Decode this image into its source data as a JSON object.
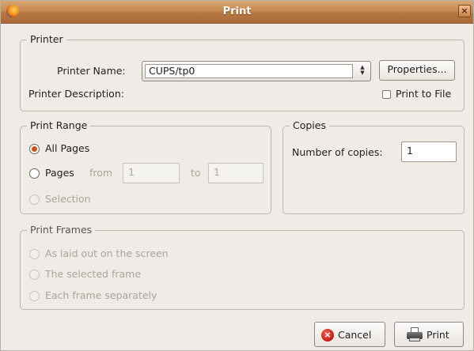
{
  "window": {
    "title": "Print",
    "close_glyph": "×"
  },
  "printer": {
    "group_label": "Printer",
    "name_label": "Printer Name:",
    "selected_printer": "CUPS/tp0",
    "properties_label": "Properties...",
    "description_label": "Printer Description:",
    "print_to_file_label": "Print to File",
    "print_to_file_checked": false
  },
  "print_range": {
    "group_label": "Print Range",
    "all_pages_label": "All Pages",
    "all_pages_selected": true,
    "pages_label": "Pages",
    "from_label": "from",
    "from_value": "1",
    "to_label": "to",
    "to_value": "1",
    "selection_label": "Selection"
  },
  "copies": {
    "group_label": "Copies",
    "number_label": "Number of copies:",
    "number_value": "1"
  },
  "print_frames": {
    "group_label": "Print Frames",
    "options": [
      "As laid out on the screen",
      "The selected frame",
      "Each frame separately"
    ]
  },
  "actions": {
    "cancel_label": "Cancel",
    "print_label": "Print"
  },
  "icons": {
    "app": "firefox-icon",
    "close": "close-icon",
    "cancel": "cancel-icon",
    "print": "printer-icon",
    "combo_arrows": "updown-arrows-icon"
  },
  "colors": {
    "titlebar": "#c78a52",
    "window_bg": "#efebe7",
    "radio_selected": "#c8551b",
    "cancel_icon": "#c2180f"
  }
}
